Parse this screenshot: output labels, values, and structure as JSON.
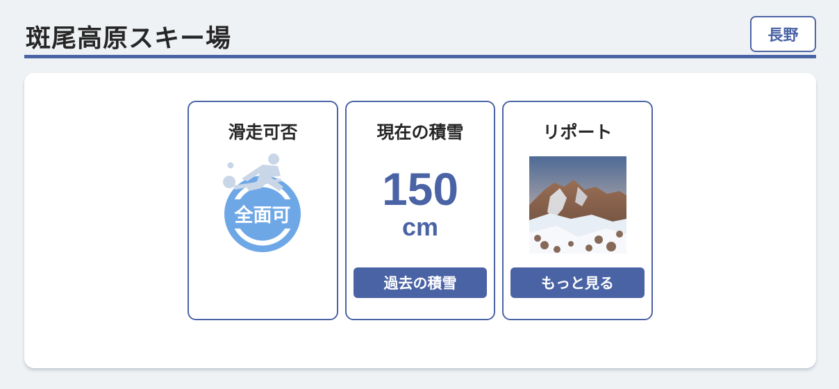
{
  "header": {
    "title": "斑尾高原スキー場",
    "region_button": "長野"
  },
  "cards": {
    "status": {
      "title": "滑走可否",
      "badge": "全面可",
      "icon": "skier-icon"
    },
    "snow": {
      "title": "現在の積雪",
      "value": "150",
      "unit": "cm",
      "button": "過去の積雪"
    },
    "report": {
      "title": "リポート",
      "button": "もっと見る",
      "image": "ski-slope-photo"
    }
  },
  "colors": {
    "accent": "#4a63a5",
    "badge": "#6ea7e6",
    "background": "#eff2f4"
  }
}
